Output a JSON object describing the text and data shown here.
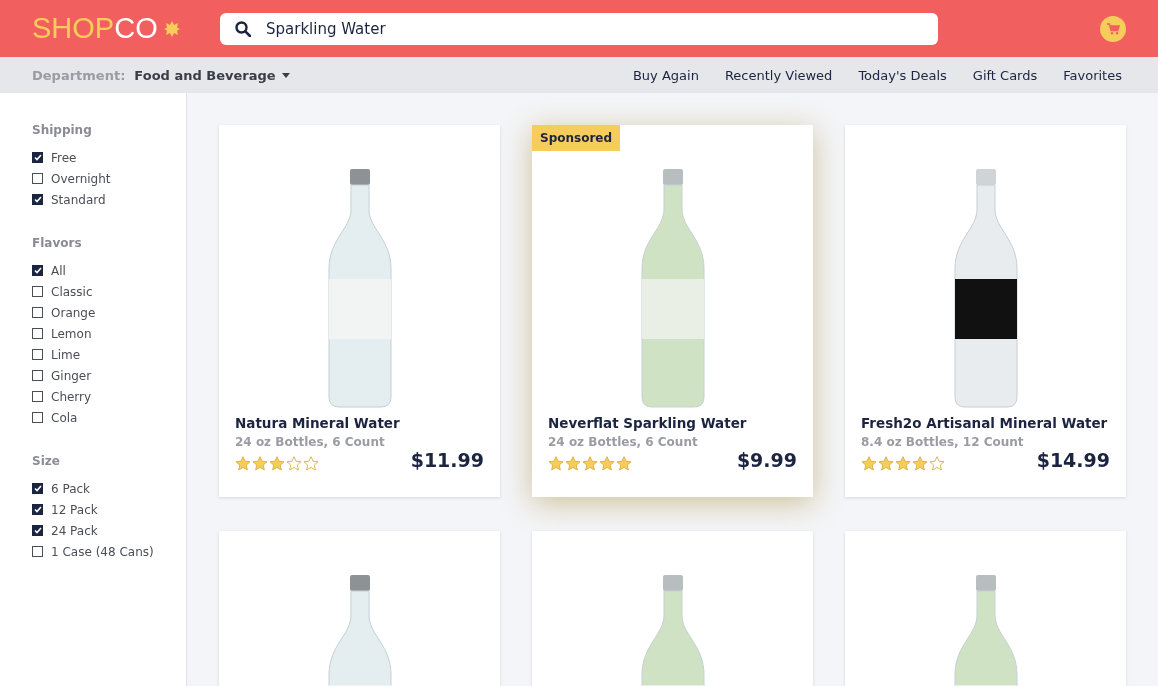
{
  "header": {
    "logo": {
      "first": "SHOP",
      "second": "CO"
    },
    "search": {
      "value": "Sparkling Water"
    }
  },
  "subnav": {
    "department_label": "Department:",
    "department": "Food and Beverage",
    "links": [
      "Buy Again",
      "Recently Viewed",
      "Today's Deals",
      "Gift Cards",
      "Favorites"
    ]
  },
  "filters": [
    {
      "title": "Shipping",
      "options": [
        {
          "label": "Free",
          "checked": true
        },
        {
          "label": "Overnight",
          "checked": false
        },
        {
          "label": "Standard",
          "checked": true
        }
      ]
    },
    {
      "title": "Flavors",
      "options": [
        {
          "label": "All",
          "checked": true
        },
        {
          "label": "Classic",
          "checked": false
        },
        {
          "label": "Orange",
          "checked": false
        },
        {
          "label": "Lemon",
          "checked": false
        },
        {
          "label": "Lime",
          "checked": false
        },
        {
          "label": "Ginger",
          "checked": false
        },
        {
          "label": "Cherry",
          "checked": false
        },
        {
          "label": "Cola",
          "checked": false
        }
      ]
    },
    {
      "title": "Size",
      "options": [
        {
          "label": "6 Pack",
          "checked": true
        },
        {
          "label": "12 Pack",
          "checked": true
        },
        {
          "label": "24 Pack",
          "checked": true
        },
        {
          "label": "1 Case (48 Cans)",
          "checked": false
        }
      ]
    }
  ],
  "products": [
    {
      "kind": "clear",
      "highlighted": false,
      "name": "Natura Mineral Water",
      "detail": "24 oz Bottles, 6 Count",
      "stars": 3,
      "price": "$11.99"
    },
    {
      "kind": "green",
      "highlighted": true,
      "badge": "Sponsored",
      "name": "Neverflat Sparkling Water",
      "detail": "24 oz Bottles, 6 Count",
      "stars": 5,
      "price": "$9.99"
    },
    {
      "kind": "dark",
      "highlighted": false,
      "name": "Fresh2o Artisanal Mineral Water",
      "detail": "8.4 oz Bottles, 12 Count",
      "stars": 4,
      "price": "$14.99"
    },
    {
      "kind": "clear",
      "highlighted": false
    },
    {
      "kind": "green",
      "highlighted": false
    },
    {
      "kind": "green",
      "highlighted": false
    }
  ]
}
